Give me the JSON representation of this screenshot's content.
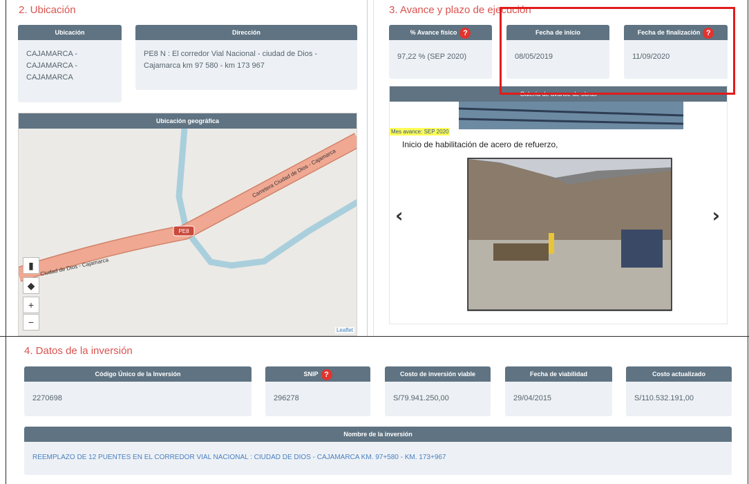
{
  "ubicacion": {
    "section_title": "2. Ubicación",
    "ubicacion_label": "Ubicación",
    "ubicacion_value": "CAJAMARCA - CAJAMARCA - CAJAMARCA",
    "direccion_label": "Dirección",
    "direccion_value": "PE8 N : El corredor Vial Nacional - ciudad de Dios - Cajamarca km 97 580 - km 173 967",
    "map_title": "Ubicación geográfica",
    "road_label_1": "Carretera Ciudad de Dios - Cajamarca",
    "road_label_2": "Ciudad de Dios - Cajamarca",
    "route_marker": "PE8",
    "attribution": "Leaflet",
    "zoom_in": "+",
    "zoom_out": "−"
  },
  "avance": {
    "section_title": "3. Avance y plazo de ejecución",
    "fisico_label": "% Avance físico",
    "fisico_value": "97,22 % (SEP 2020)",
    "inicio_label": "Fecha de inicio",
    "inicio_value": "08/05/2019",
    "fin_label": "Fecha de finalización",
    "fin_value": "11/09/2020",
    "gallery_title": "Galería de avance de obras",
    "mes_avance": "Mes avance: SEP 2020",
    "caption": "Inicio de habilitación de acero de refuerzo,",
    "prev": "‹",
    "next": "›",
    "help": "?"
  },
  "inversion": {
    "section_title": "4. Datos de la inversión",
    "codigo_label": "Código Único de la Inversión",
    "codigo_value": "2270698",
    "snip_label": "SNIP",
    "snip_value": "296278",
    "costo_label": "Costo de inversión viable",
    "costo_value": "S/79.941.250,00",
    "fecha_viab_label": "Fecha de viabilidad",
    "fecha_viab_value": "29/04/2015",
    "costo_act_label": "Costo actualizado",
    "costo_act_value": "S/110.532.191,00",
    "nombre_label": "Nombre de la inversión",
    "nombre_value": "REEMPLAZO DE 12 PUENTES EN EL CORREDOR VIAL NACIONAL : CIUDAD DE DIOS - CAJAMARCA KM. 97+580 - KM. 173+967"
  },
  "colors": {
    "accent_red": "#d9534f",
    "header_bg": "#5f7382",
    "highlight_box": "#e21b1b"
  }
}
